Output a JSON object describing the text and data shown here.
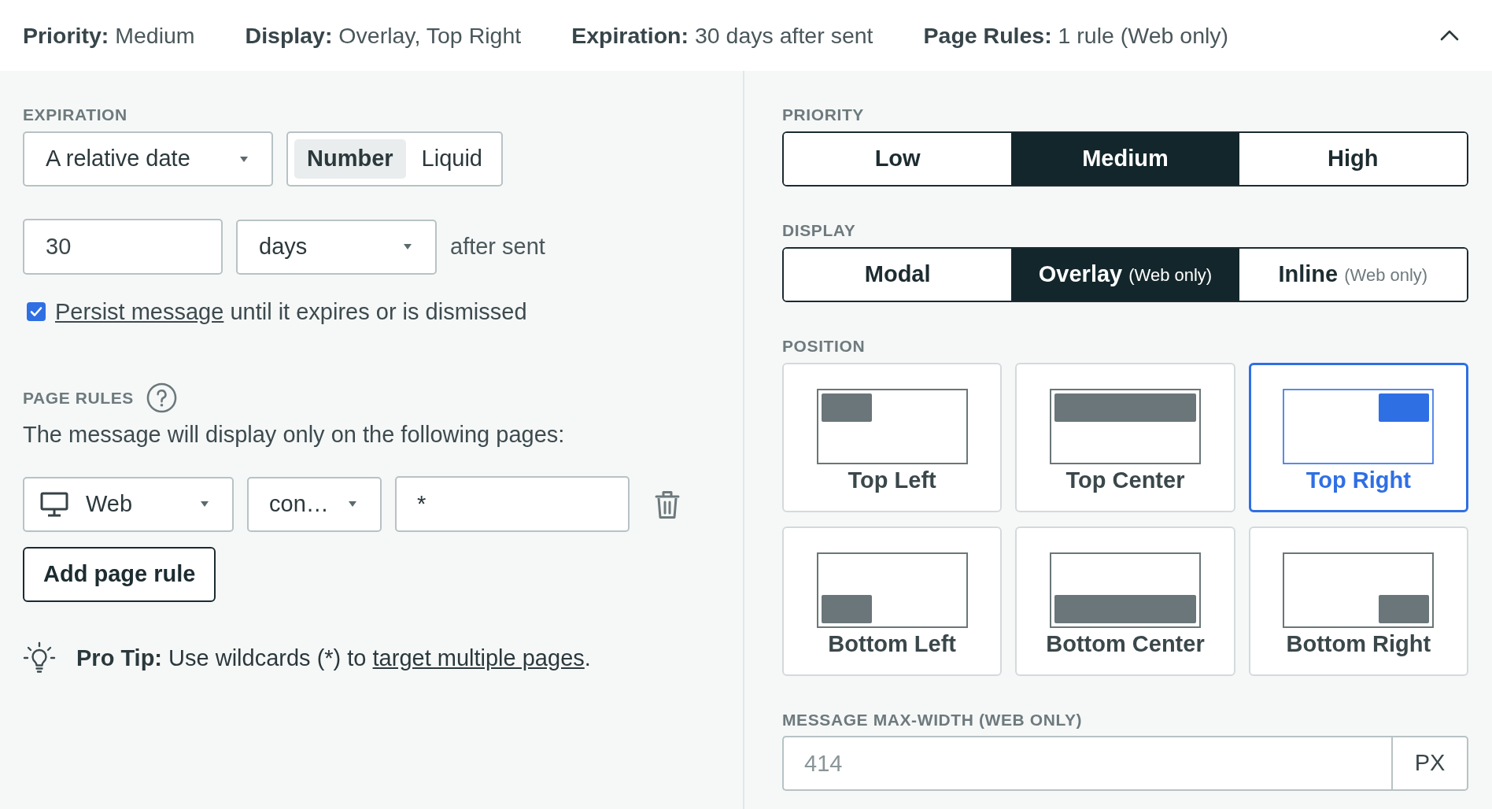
{
  "summary": {
    "items": [
      {
        "label": "Priority:",
        "value": "Medium"
      },
      {
        "label": "Display:",
        "value": "Overlay, Top Right"
      },
      {
        "label": "Expiration:",
        "value": "30 days after sent"
      },
      {
        "label": "Page Rules:",
        "value": "1 rule (Web only)"
      }
    ],
    "expanded": true
  },
  "expiration": {
    "label": "EXPIRATION",
    "date_type": {
      "value": "A relative date"
    },
    "input_mode": [
      {
        "label": "Number",
        "selected": true
      },
      {
        "label": "Liquid",
        "selected": false
      }
    ],
    "amount": {
      "value": "30"
    },
    "unit": {
      "value": "days"
    },
    "suffix": "after sent",
    "persist": {
      "checked": true,
      "link": "Persist message",
      "text": "until it expires or is dismissed"
    }
  },
  "page_rules": {
    "label": "PAGE RULES",
    "description": "The message will display only on the following pages:",
    "rules": [
      {
        "platform": "Web",
        "operator": "con…",
        "pattern": "*"
      }
    ],
    "add_button": "Add page rule"
  },
  "pro_tip": {
    "lead": "Pro Tip:",
    "text": "Use wildcards (*) to",
    "link": "target multiple pages",
    "end": "."
  },
  "priority": {
    "label": "PRIORITY",
    "options": [
      {
        "label": "Low",
        "selected": false
      },
      {
        "label": "Medium",
        "selected": true
      },
      {
        "label": "High",
        "selected": false
      }
    ]
  },
  "display": {
    "label": "DISPLAY",
    "options": [
      {
        "label": "Modal",
        "selected": false
      },
      {
        "label": "Overlay",
        "note": "(Web only)",
        "selected": true
      },
      {
        "label": "Inline",
        "note": "(Web only)",
        "selected": false
      }
    ]
  },
  "position": {
    "label": "POSITION",
    "options": [
      {
        "label": "Top Left",
        "kind": "top-left",
        "selected": false
      },
      {
        "label": "Top Center",
        "kind": "top-center",
        "selected": false
      },
      {
        "label": "Top Right",
        "kind": "top-right",
        "selected": true
      },
      {
        "label": "Bottom Left",
        "kind": "bottom-left",
        "selected": false
      },
      {
        "label": "Bottom Center",
        "kind": "bottom-center",
        "selected": false
      },
      {
        "label": "Bottom Right",
        "kind": "bottom-right",
        "selected": false
      }
    ]
  },
  "max_width": {
    "label": "MESSAGE MAX-WIDTH (WEB ONLY)",
    "placeholder": "414",
    "unit": "PX"
  }
}
